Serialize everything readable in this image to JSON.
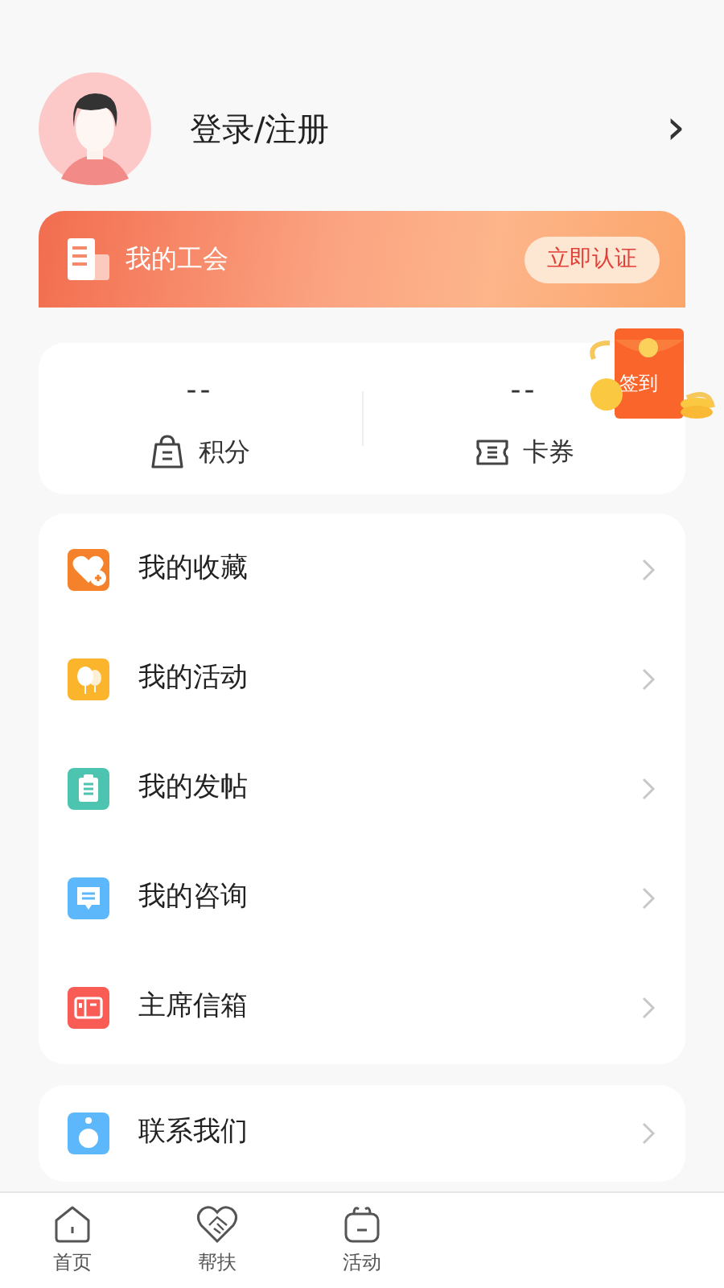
{
  "profile": {
    "login_label": "登录/注册",
    "chevron": "›"
  },
  "union_banner": {
    "title": "我的工会",
    "button": "立即认证"
  },
  "stats": [
    {
      "value": "--",
      "label": "积分",
      "kind": "points"
    },
    {
      "value": "--",
      "label": "卡券",
      "kind": "coupon"
    }
  ],
  "sign_in_badge": {
    "label": "签到"
  },
  "menu": [
    {
      "label": "我的收藏",
      "kind": "favorite",
      "color": "#f5822a"
    },
    {
      "label": "我的活动",
      "kind": "activity",
      "color": "#fbb52c"
    },
    {
      "label": "我的发帖",
      "kind": "post",
      "color": "#4cc4b0"
    },
    {
      "label": "我的咨询",
      "kind": "consult",
      "color": "#5db8fb"
    },
    {
      "label": "主席信箱",
      "kind": "mailbox",
      "color": "#f95c55"
    }
  ],
  "menu_2": [
    {
      "label": "联系我们",
      "kind": "contact",
      "color": "#5db8fb"
    }
  ],
  "bottom_nav": [
    {
      "label": "首页",
      "kind": "home"
    },
    {
      "label": "帮扶",
      "kind": "help"
    },
    {
      "label": "活动",
      "kind": "activity"
    }
  ]
}
